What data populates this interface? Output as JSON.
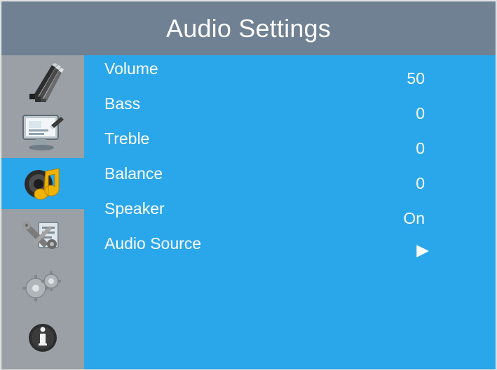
{
  "header": {
    "title": "Audio Settings"
  },
  "sidebar": {
    "items": [
      {
        "id": "picture",
        "icon": "paintbrush-icon",
        "active": false
      },
      {
        "id": "display",
        "icon": "monitor-icon",
        "active": false
      },
      {
        "id": "audio",
        "icon": "speaker-music-icon",
        "active": true
      },
      {
        "id": "setup",
        "icon": "tools-icon",
        "active": false
      },
      {
        "id": "advanced",
        "icon": "gears-icon",
        "active": false
      },
      {
        "id": "info",
        "icon": "info-icon",
        "active": false
      }
    ]
  },
  "menu": {
    "items": [
      {
        "label": "Volume",
        "value": "50"
      },
      {
        "label": "Bass",
        "value": "0"
      },
      {
        "label": "Treble",
        "value": "0"
      },
      {
        "label": "Balance",
        "value": "0"
      },
      {
        "label": "Speaker",
        "value": "On"
      },
      {
        "label": "Audio Source",
        "value": "▶"
      }
    ]
  },
  "colors": {
    "header_bg": "#6f8192",
    "sidebar_bg": "#9aa0a6",
    "accent": "#2aa7ea",
    "text": "#ffffff"
  }
}
